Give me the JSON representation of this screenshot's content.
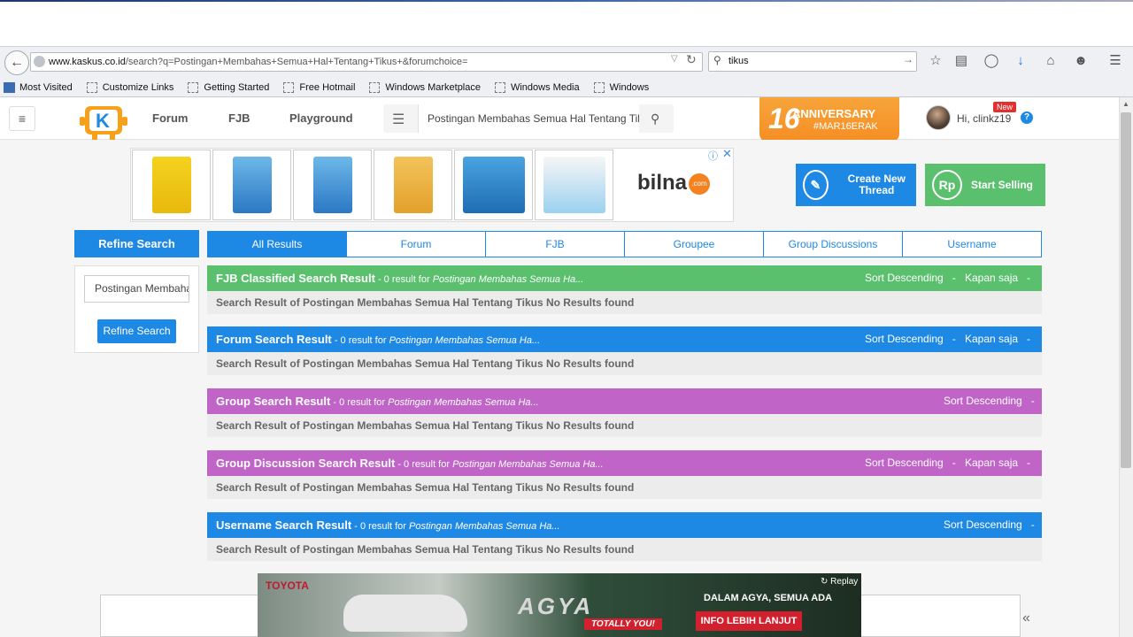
{
  "browser": {
    "url_host": "www.kaskus.co.id",
    "url_path": "/search?q=Postingan+Membahas+Semua+Hal+Tentang+Tikus+&forumchoice=",
    "search_value": "tikus",
    "bookmarks": [
      "Most Visited",
      "Customize Links",
      "Getting Started",
      "Free Hotmail",
      "Windows Marketplace",
      "Windows Media",
      "Windows"
    ]
  },
  "header": {
    "nav": [
      "Forum",
      "FJB",
      "Playground"
    ],
    "search_value": "Postingan Membahas Semua Hal Tentang Tik",
    "anniversary_num": "16",
    "anniversary_title": "ANNIVERSARY",
    "anniversary_tag": "#MAR16ERAK",
    "greeting": "Hi, clinkz19",
    "new_badge": "New",
    "help": "?"
  },
  "ad": {
    "brand": "bilna",
    "brand_suffix": ".com"
  },
  "cta": {
    "create_thread": "Create New Thread",
    "start_selling": "Start Selling",
    "rp": "Rp"
  },
  "refine": {
    "title": "Refine Search",
    "input_value": "Postingan Membahas",
    "button": "Refine Search"
  },
  "tabs": [
    "All Results",
    "Forum",
    "FJB",
    "Groupee",
    "Group Discussions",
    "Username"
  ],
  "sections": [
    {
      "title": "FJB Classified Search Result",
      "count": " - 0 result for ",
      "query": "Postingan Membahas Semua Ha...",
      "sort": "Sort Descending",
      "time": "Kapan saja",
      "body": "Search Result of Postingan Membahas Semua Hal Tentang Tikus No Results found"
    },
    {
      "title": "Forum Search Result",
      "count": " - 0 result for ",
      "query": "Postingan Membahas Semua Ha...",
      "sort": "Sort Descending",
      "time": "Kapan saja",
      "body": "Search Result of Postingan Membahas Semua Hal Tentang Tikus No Results found"
    },
    {
      "title": "Group Search Result",
      "count": " - 0 result for ",
      "query": "Postingan Membahas Semua Ha...",
      "sort": "Sort Descending",
      "time": "",
      "body": "Search Result of Postingan Membahas Semua Hal Tentang Tikus No Results found"
    },
    {
      "title": "Group Discussion Search Result",
      "count": " - 0 result for ",
      "query": "Postingan Membahas Semua Ha...",
      "sort": "Sort Descending",
      "time": "Kapan saja",
      "body": "Search Result of Postingan Membahas Semua Hal Tentang Tikus No Results found"
    },
    {
      "title": "Username Search Result",
      "count": " - 0 result for ",
      "query": "Postingan Membahas Semua Ha...",
      "sort": "Sort Descending",
      "time": "",
      "body": "Search Result of Postingan Membahas Semua Hal Tentang Tikus No Results found"
    }
  ],
  "bottom_ad": {
    "brand": "TOYOTA",
    "model": "AGYA",
    "tagline": "DALAM AGYA, SEMUA ADA",
    "cta": "INFO LEBIH LANJUT",
    "slogan": "TOTALLY YOU!",
    "replay": "Replay"
  },
  "colors": {
    "blue": "#1e88e5",
    "green": "#5ac06e",
    "purple": "#c064c8",
    "orange": "#f58e24"
  }
}
